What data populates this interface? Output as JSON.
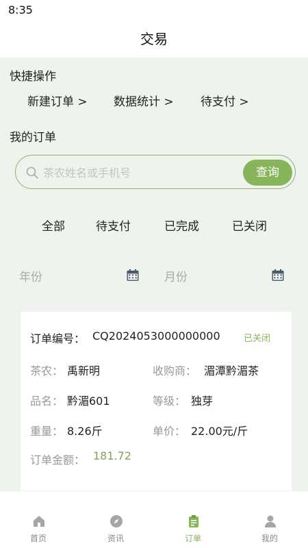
{
  "status_bar": {
    "time": "8:35"
  },
  "header": {
    "title": "交易"
  },
  "quick_actions": {
    "title": "快捷操作",
    "items": [
      {
        "label": "新建订单 >"
      },
      {
        "label": "数据统计 >"
      },
      {
        "label": "待支付 >"
      }
    ]
  },
  "my_orders": {
    "title": "我的订单",
    "search": {
      "placeholder": "茶农姓名或手机号",
      "button": "查询"
    },
    "tabs": [
      {
        "label": "全部"
      },
      {
        "label": "待支付"
      },
      {
        "label": "已完成"
      },
      {
        "label": "已关闭"
      }
    ],
    "filters": {
      "year": "年份",
      "month": "月份"
    }
  },
  "order_card": {
    "order_no_label": "订单编号：",
    "order_no": "CQ2024053000000000",
    "status": "已关闭",
    "farmer_label": "茶农：",
    "farmer": "禹新明",
    "buyer_label": "收购商：",
    "buyer": "湄潭黔湄茶",
    "product_label": "品名：",
    "product": "黔湄601",
    "grade_label": "等级：",
    "grade": "独芽",
    "weight_label": "重量：",
    "weight": "8.26斤",
    "price_label": "单价：",
    "price": "22.00元/斤",
    "amount_label": "订单金额：",
    "amount": "181.72"
  },
  "bottom_nav": {
    "items": [
      {
        "label": "首页",
        "icon": "home-icon"
      },
      {
        "label": "资讯",
        "icon": "compass-icon"
      },
      {
        "label": "订单",
        "icon": "clipboard-icon"
      },
      {
        "label": "我的",
        "icon": "user-icon"
      }
    ],
    "active_index": 2
  },
  "colors": {
    "accent": "#86b55a",
    "background": "#eef3ee"
  }
}
